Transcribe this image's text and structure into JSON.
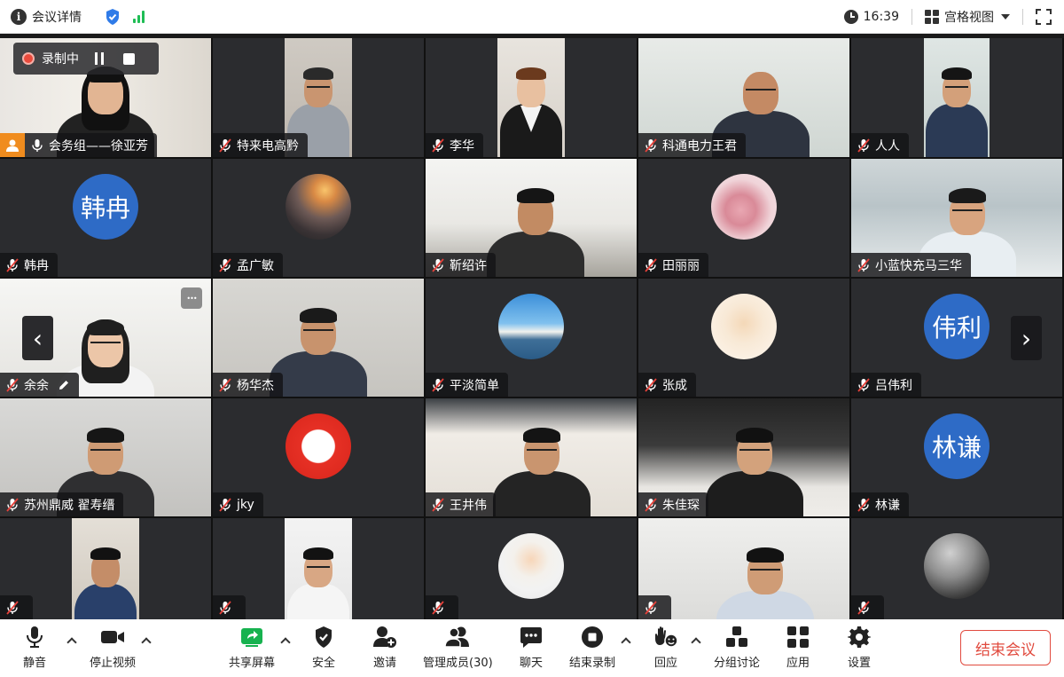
{
  "topbar": {
    "title": "会议详情",
    "time": "16:39",
    "view_label": "宫格视图"
  },
  "recording": {
    "label": "录制中"
  },
  "participants": [
    {
      "name": "会务组——徐亚芳",
      "mic": "on",
      "type": "video",
      "host": true
    },
    {
      "name": "特来电高黔",
      "mic": "off",
      "type": "video"
    },
    {
      "name": "李华",
      "mic": "off",
      "type": "video"
    },
    {
      "name": "科通电力王君",
      "mic": "off",
      "type": "video"
    },
    {
      "name": "人人",
      "mic": "off",
      "type": "video"
    },
    {
      "name": "韩冉",
      "mic": "off",
      "type": "avatar",
      "initials": "韩冉"
    },
    {
      "name": "孟广敏",
      "mic": "off",
      "type": "image"
    },
    {
      "name": "靳绍许",
      "mic": "off",
      "type": "video"
    },
    {
      "name": "田丽丽",
      "mic": "off",
      "type": "image"
    },
    {
      "name": "小蓝快充马三华",
      "mic": "off",
      "type": "video"
    },
    {
      "name": "余余",
      "mic": "off",
      "type": "video",
      "editable": true
    },
    {
      "name": "杨华杰",
      "mic": "off",
      "type": "video"
    },
    {
      "name": "平淡简单",
      "mic": "off",
      "type": "image"
    },
    {
      "name": "张成",
      "mic": "off",
      "type": "image"
    },
    {
      "name": "吕伟利",
      "mic": "off",
      "type": "avatar",
      "initials": "伟利"
    },
    {
      "name": "苏州鼎威 翟寿缙",
      "mic": "off",
      "type": "video"
    },
    {
      "name": "jky",
      "mic": "off",
      "type": "image"
    },
    {
      "name": "王井伟",
      "mic": "off",
      "type": "video"
    },
    {
      "name": "朱佳琛",
      "mic": "off",
      "type": "video"
    },
    {
      "name": "林谦",
      "mic": "off",
      "type": "avatar",
      "initials": "林谦"
    },
    {
      "name": "",
      "mic": "off",
      "type": "video"
    },
    {
      "name": "",
      "mic": "off",
      "type": "video"
    },
    {
      "name": "",
      "mic": "off",
      "type": "image"
    },
    {
      "name": "",
      "mic": "off",
      "type": "video"
    },
    {
      "name": "",
      "mic": "off",
      "type": "image"
    }
  ],
  "toolbar": {
    "mute": "静音",
    "stop_video": "停止视频",
    "share_screen": "共享屏幕",
    "security": "安全",
    "invite": "邀请",
    "manage_members": "管理成员(30)",
    "chat": "聊天",
    "end_recording": "结束录制",
    "reactions": "回应",
    "breakout": "分组讨论",
    "apps": "应用",
    "settings": "设置",
    "end_meeting": "结束会议"
  },
  "colors": {
    "avatar_blue": "#2e6bc6",
    "end_red": "#e14b3f",
    "record_red": "#e94a3c",
    "signal_green": "#1fbd55",
    "share_green": "#17b24f"
  }
}
